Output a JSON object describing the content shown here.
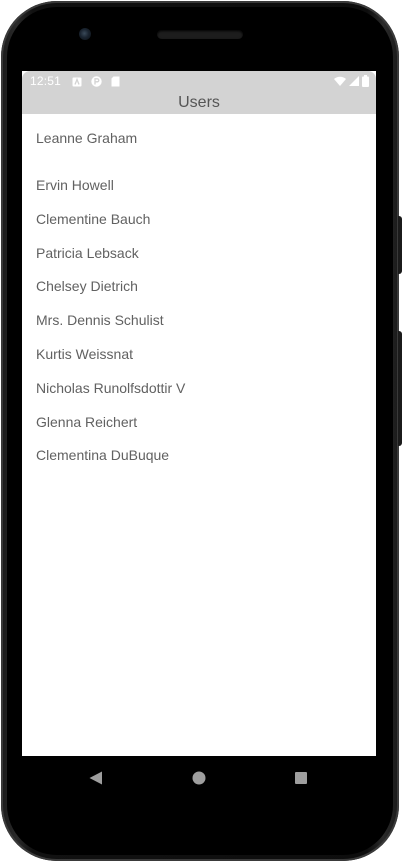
{
  "status_bar": {
    "time": "12:51",
    "left_icons": [
      "notification-a-icon",
      "notification-p-icon",
      "sd-card-icon"
    ],
    "right_icons": [
      "wifi-icon",
      "cell-signal-icon",
      "battery-icon"
    ]
  },
  "app_bar": {
    "title": "Users"
  },
  "users": [
    "Leanne Graham",
    "Ervin Howell",
    "Clementine Bauch",
    "Patricia Lebsack",
    "Chelsey Dietrich",
    "Mrs. Dennis Schulist",
    "Kurtis Weissnat",
    "Nicholas Runolfsdottir V",
    "Glenna Reichert",
    "Clementina DuBuque"
  ],
  "nav_bar": {
    "buttons": [
      "back-icon",
      "home-icon",
      "recents-icon"
    ]
  },
  "colors": {
    "bar_background": "#d3d3d3",
    "title_text": "#555555",
    "list_text": "#616161",
    "screen_background": "#ffffff"
  }
}
